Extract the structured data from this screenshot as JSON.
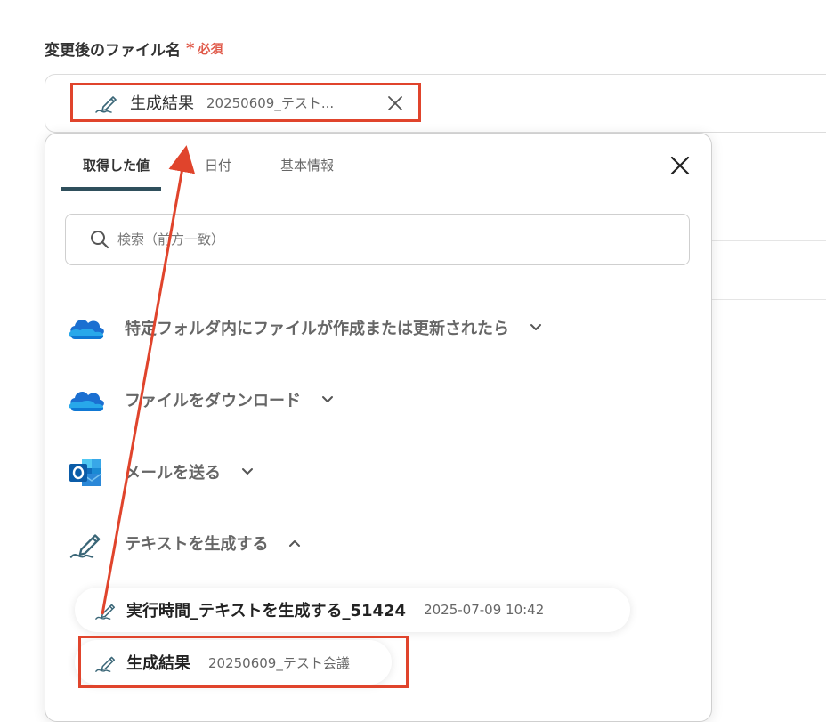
{
  "field": {
    "label": "変更後のファイル名",
    "required_mark": "*",
    "required_text": "必須"
  },
  "chip": {
    "label": "生成結果",
    "value": "20250609_テスト..."
  },
  "popup": {
    "tabs": [
      {
        "label": "取得した値",
        "active": true
      },
      {
        "label": "日付",
        "active": false
      },
      {
        "label": "基本情報",
        "active": false
      }
    ],
    "search_placeholder": "検索（前方一致）",
    "sections": [
      {
        "label": "特定フォルダ内にファイルが作成または更新されたら",
        "icon": "onedrive-icon",
        "expanded": false
      },
      {
        "label": "ファイルをダウンロード",
        "icon": "onedrive-icon",
        "expanded": false
      },
      {
        "label": "メールを送る",
        "icon": "outlook-icon",
        "expanded": false
      },
      {
        "label": "テキストを生成する",
        "icon": "pencil-icon",
        "expanded": true
      }
    ],
    "items": [
      {
        "label": "実行時間_テキストを生成する_51424",
        "value": "2025-07-09 10:42"
      },
      {
        "label": "生成結果",
        "value": "20250609_テスト会議"
      }
    ]
  },
  "colors": {
    "accent_red": "#e0442c",
    "required_red": "#e05a4a",
    "tab_underline": "#2f4f5c"
  }
}
